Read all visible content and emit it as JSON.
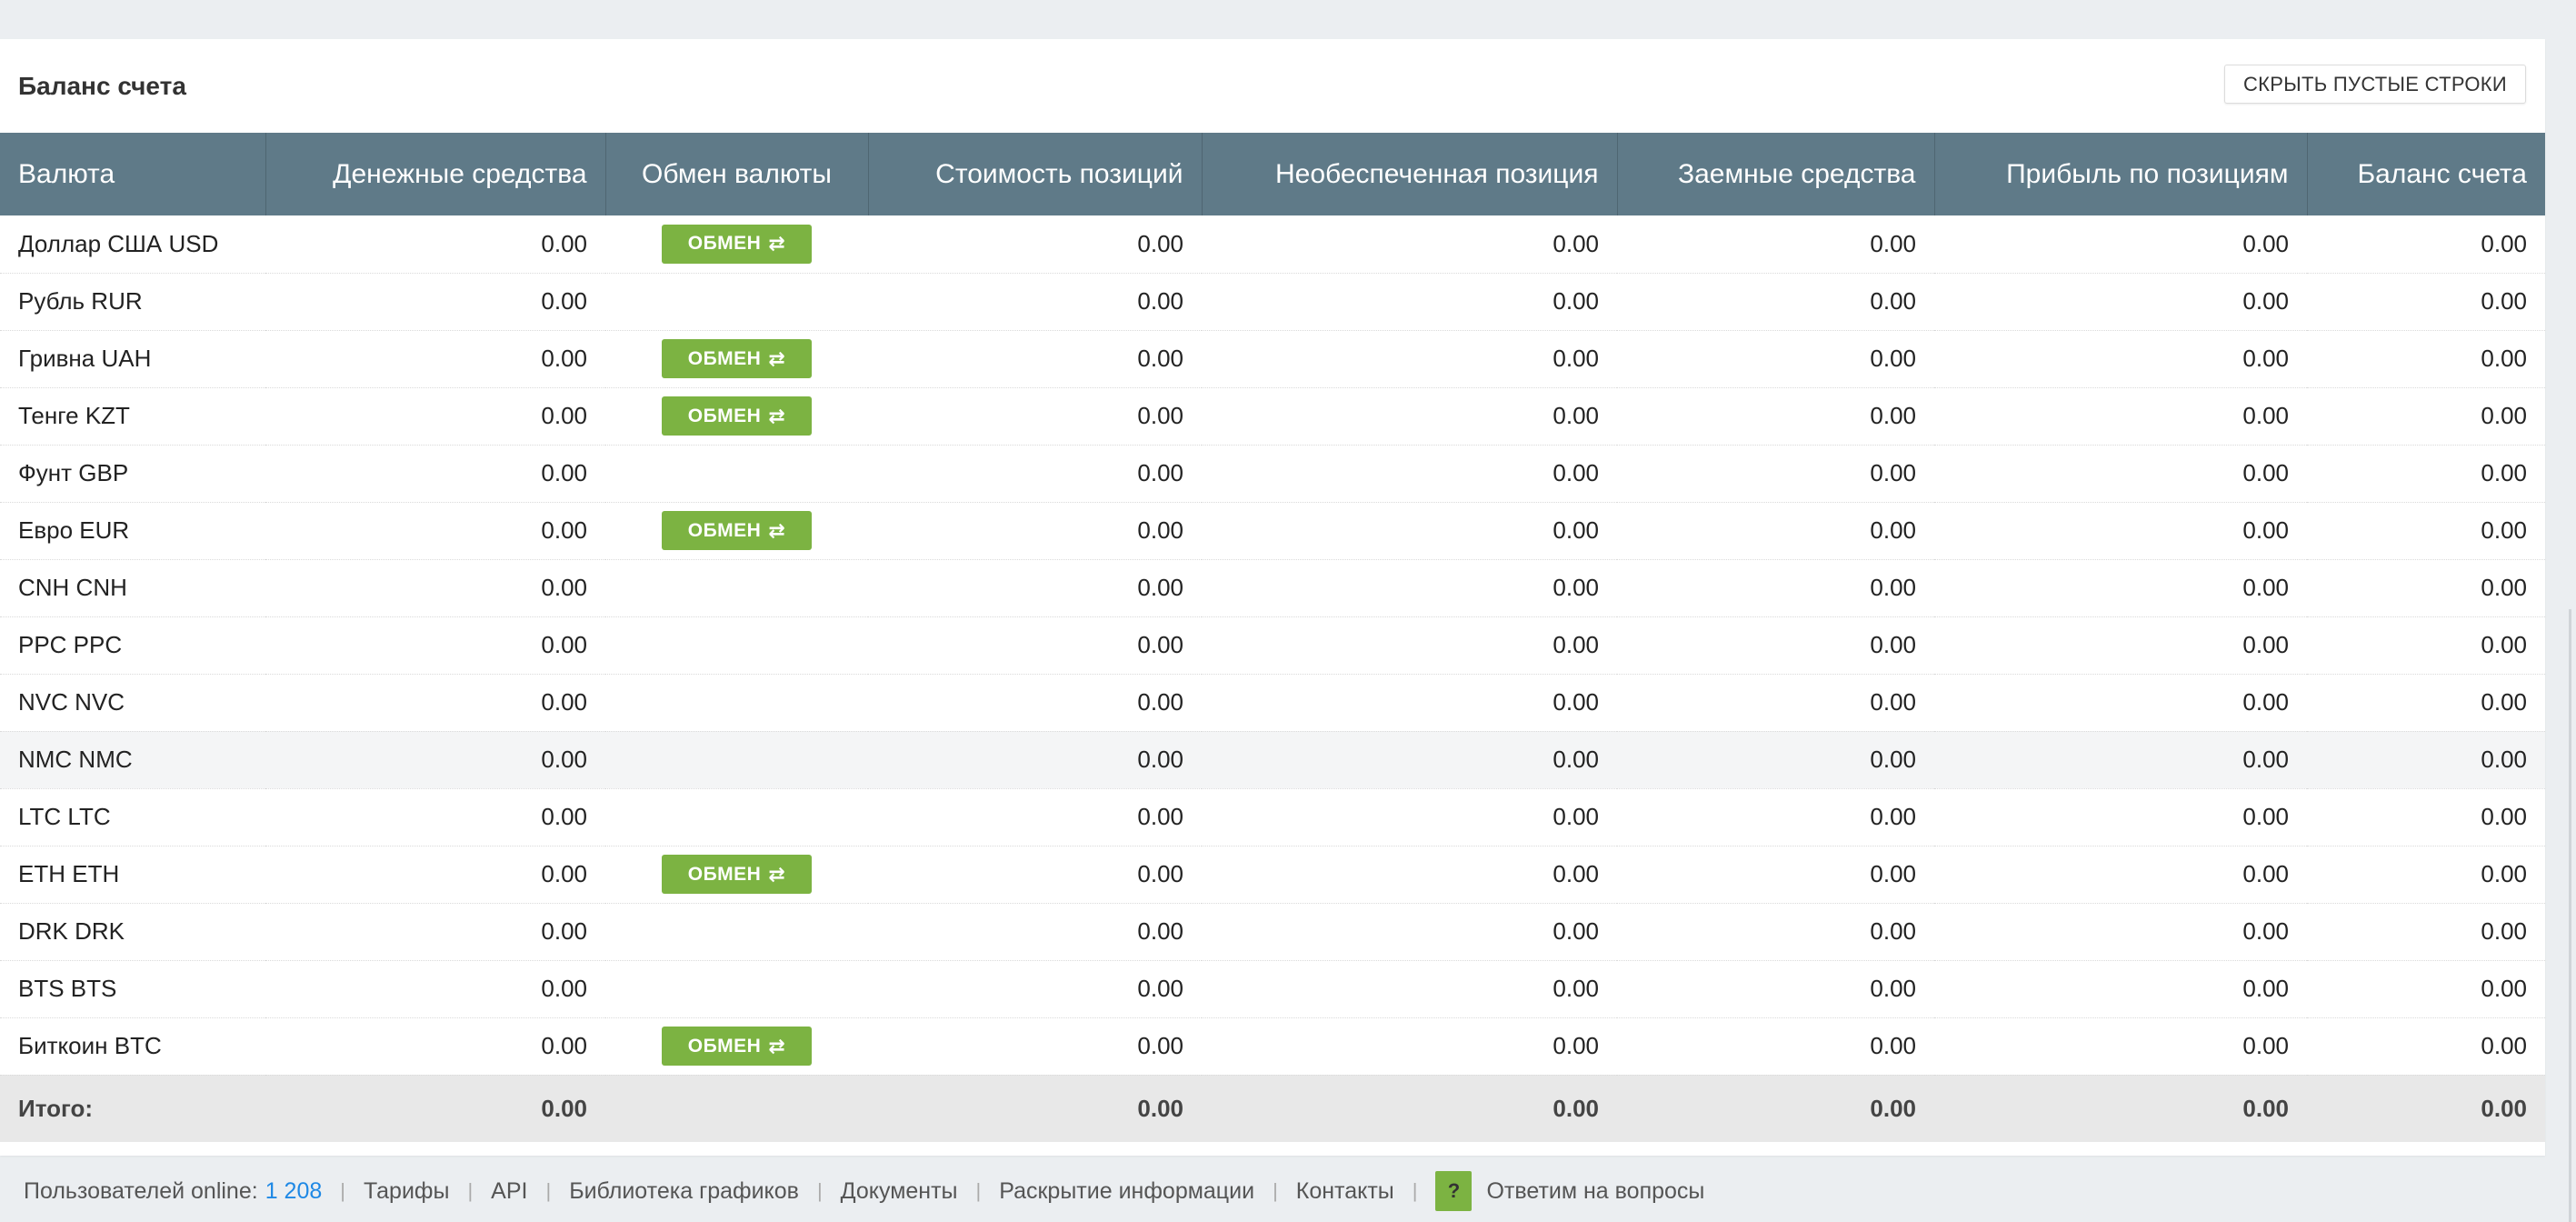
{
  "panel": {
    "title": "Баланс счета",
    "hide_button_label": "СКРЫТЬ ПУСТЫЕ СТРОКИ"
  },
  "table": {
    "columns": [
      "Валюта",
      "Денежные средства",
      "Обмен валюты",
      "Стоимость позиций",
      "Необеспеченная позиция",
      "Заемные средства",
      "Прибыль по позициям",
      "Баланс счета"
    ],
    "exchange_label": "ОБМЕН",
    "rows": [
      {
        "currency": "Доллар США USD",
        "cash": "0.00",
        "exchange": true,
        "positions": "0.00",
        "uncovered": "0.00",
        "borrowed": "0.00",
        "profit": "0.00",
        "balance": "0.00"
      },
      {
        "currency": "Рубль RUR",
        "cash": "0.00",
        "exchange": false,
        "positions": "0.00",
        "uncovered": "0.00",
        "borrowed": "0.00",
        "profit": "0.00",
        "balance": "0.00"
      },
      {
        "currency": "Гривна UAH",
        "cash": "0.00",
        "exchange": true,
        "positions": "0.00",
        "uncovered": "0.00",
        "borrowed": "0.00",
        "profit": "0.00",
        "balance": "0.00"
      },
      {
        "currency": "Тенге KZT",
        "cash": "0.00",
        "exchange": true,
        "positions": "0.00",
        "uncovered": "0.00",
        "borrowed": "0.00",
        "profit": "0.00",
        "balance": "0.00"
      },
      {
        "currency": "Фунт GBP",
        "cash": "0.00",
        "exchange": false,
        "positions": "0.00",
        "uncovered": "0.00",
        "borrowed": "0.00",
        "profit": "0.00",
        "balance": "0.00"
      },
      {
        "currency": "Евро EUR",
        "cash": "0.00",
        "exchange": true,
        "positions": "0.00",
        "uncovered": "0.00",
        "borrowed": "0.00",
        "profit": "0.00",
        "balance": "0.00"
      },
      {
        "currency": "CNH CNH",
        "cash": "0.00",
        "exchange": false,
        "positions": "0.00",
        "uncovered": "0.00",
        "borrowed": "0.00",
        "profit": "0.00",
        "balance": "0.00"
      },
      {
        "currency": "PPC PPC",
        "cash": "0.00",
        "exchange": false,
        "positions": "0.00",
        "uncovered": "0.00",
        "borrowed": "0.00",
        "profit": "0.00",
        "balance": "0.00"
      },
      {
        "currency": "NVC NVC",
        "cash": "0.00",
        "exchange": false,
        "positions": "0.00",
        "uncovered": "0.00",
        "borrowed": "0.00",
        "profit": "0.00",
        "balance": "0.00"
      },
      {
        "currency": "NMC NMC",
        "cash": "0.00",
        "exchange": false,
        "positions": "0.00",
        "uncovered": "0.00",
        "borrowed": "0.00",
        "profit": "0.00",
        "balance": "0.00",
        "hovered": true
      },
      {
        "currency": "LTC LTC",
        "cash": "0.00",
        "exchange": false,
        "positions": "0.00",
        "uncovered": "0.00",
        "borrowed": "0.00",
        "profit": "0.00",
        "balance": "0.00"
      },
      {
        "currency": "ETH ETH",
        "cash": "0.00",
        "exchange": true,
        "positions": "0.00",
        "uncovered": "0.00",
        "borrowed": "0.00",
        "profit": "0.00",
        "balance": "0.00"
      },
      {
        "currency": "DRK DRK",
        "cash": "0.00",
        "exchange": false,
        "positions": "0.00",
        "uncovered": "0.00",
        "borrowed": "0.00",
        "profit": "0.00",
        "balance": "0.00"
      },
      {
        "currency": "BTS BTS",
        "cash": "0.00",
        "exchange": false,
        "positions": "0.00",
        "uncovered": "0.00",
        "borrowed": "0.00",
        "profit": "0.00",
        "balance": "0.00"
      },
      {
        "currency": "Биткоин BTC",
        "cash": "0.00",
        "exchange": true,
        "positions": "0.00",
        "uncovered": "0.00",
        "borrowed": "0.00",
        "profit": "0.00",
        "balance": "0.00"
      }
    ],
    "total": {
      "label": "Итого:",
      "cash": "0.00",
      "positions": "0.00",
      "uncovered": "0.00",
      "borrowed": "0.00",
      "profit": "0.00",
      "balance": "0.00"
    }
  },
  "footer": {
    "online_label": "Пользователей online:",
    "online_count": "1 208",
    "links": [
      "Тарифы",
      "API",
      "Библиотека графиков",
      "Документы",
      "Раскрытие информации",
      "Контакты"
    ],
    "help_icon_glyph": "?",
    "help_label": "Ответим на вопросы"
  },
  "colors": {
    "header_bg": "#5f7a88",
    "exchange_button": "#7cb342",
    "link_accent": "#1e88e5"
  }
}
